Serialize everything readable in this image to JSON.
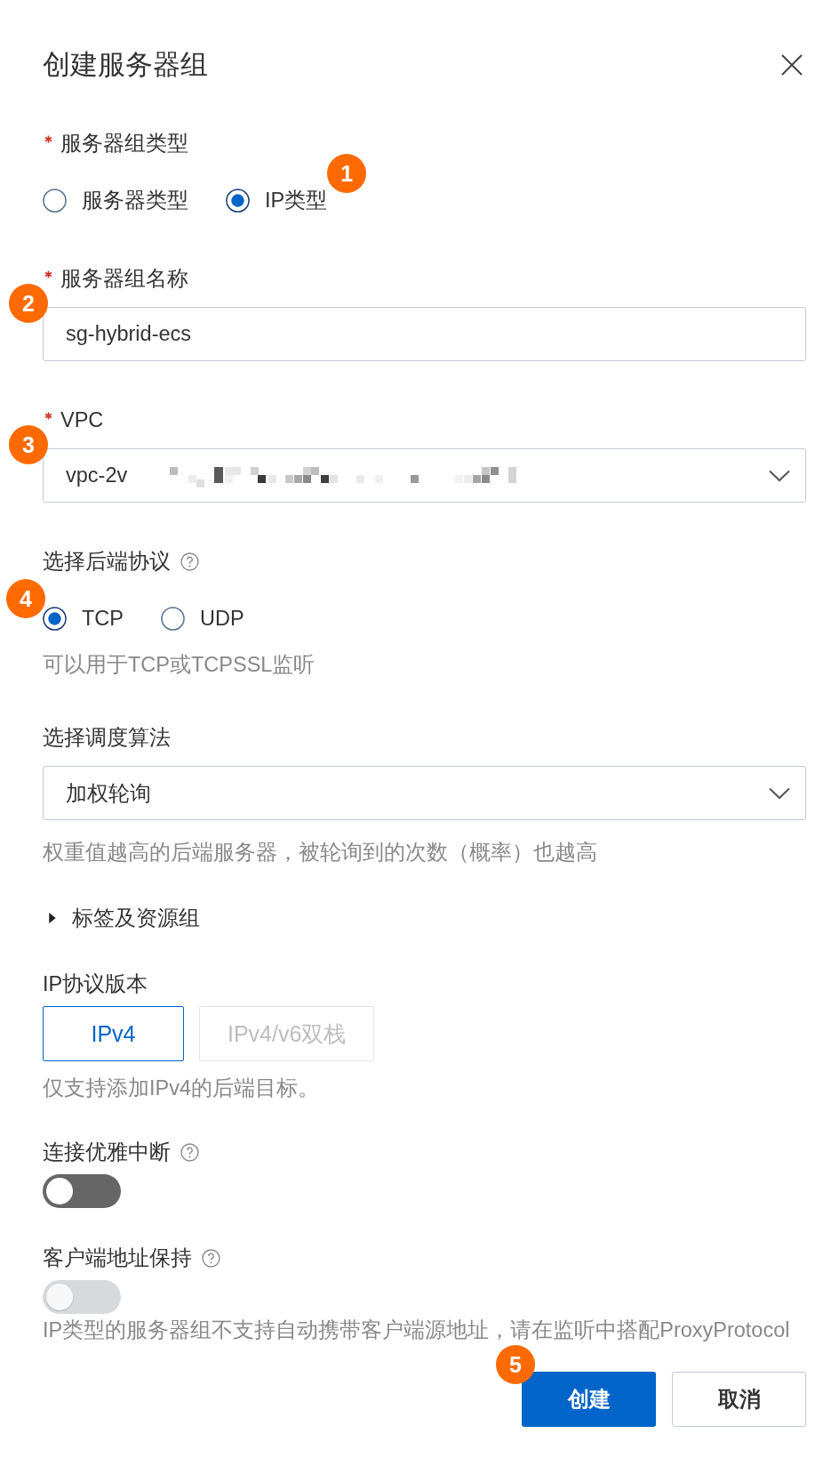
{
  "dialog": {
    "title": "创建服务器组"
  },
  "fields": [
    {
      "kind": "radio",
      "label": "服务器组类型",
      "required": true,
      "help": false,
      "options": [
        {
          "label": "服务器类型",
          "selected": false
        },
        {
          "label": "IP类型",
          "selected": true,
          "callout": "1"
        }
      ]
    },
    {
      "kind": "input",
      "label": "服务器组名称",
      "required": true,
      "help": false,
      "value": "sg-hybrid-ecs",
      "callout": "2"
    },
    {
      "kind": "select",
      "label": "VPC",
      "required": true,
      "help": false,
      "value": "vpc-2v",
      "redacted": true,
      "callout": "3"
    },
    {
      "kind": "radio",
      "label": "选择后端协议",
      "required": false,
      "help": true,
      "options": [
        {
          "label": "TCP",
          "selected": true,
          "callout": "4"
        },
        {
          "label": "UDP",
          "selected": false
        }
      ],
      "hint": "可以用于TCP或TCPSSL监听"
    },
    {
      "kind": "select",
      "label": "选择调度算法",
      "required": false,
      "help": false,
      "value": "加权轮询",
      "redacted": false,
      "hint": "权重值越高的后端服务器，被轮询到的次数（概率）也越高"
    },
    {
      "kind": "collapse",
      "label": "标签及资源组",
      "expanded": false
    },
    {
      "kind": "segmented",
      "label": "IP协议版本",
      "required": false,
      "help": false,
      "options": [
        {
          "label": "IPv4",
          "selected": true,
          "disabled": false
        },
        {
          "label": "IPv4/v6双栈",
          "selected": false,
          "disabled": true
        }
      ],
      "hint": "仅支持添加IPv4的后端目标。"
    },
    {
      "kind": "switch",
      "label": "连接优雅中断",
      "required": false,
      "help": true,
      "on": false,
      "disabled": false
    },
    {
      "kind": "switch",
      "label": "客户端地址保持",
      "required": false,
      "help": true,
      "on": false,
      "disabled": true,
      "hint": "IP类型的服务器组不支持自动携带客户端源地址，请在监听中搭配ProxyProtocol"
    }
  ],
  "buttons": [
    {
      "label": "创建",
      "kind": "primary",
      "callout": "5"
    },
    {
      "label": "取消",
      "kind": "secondary"
    }
  ]
}
